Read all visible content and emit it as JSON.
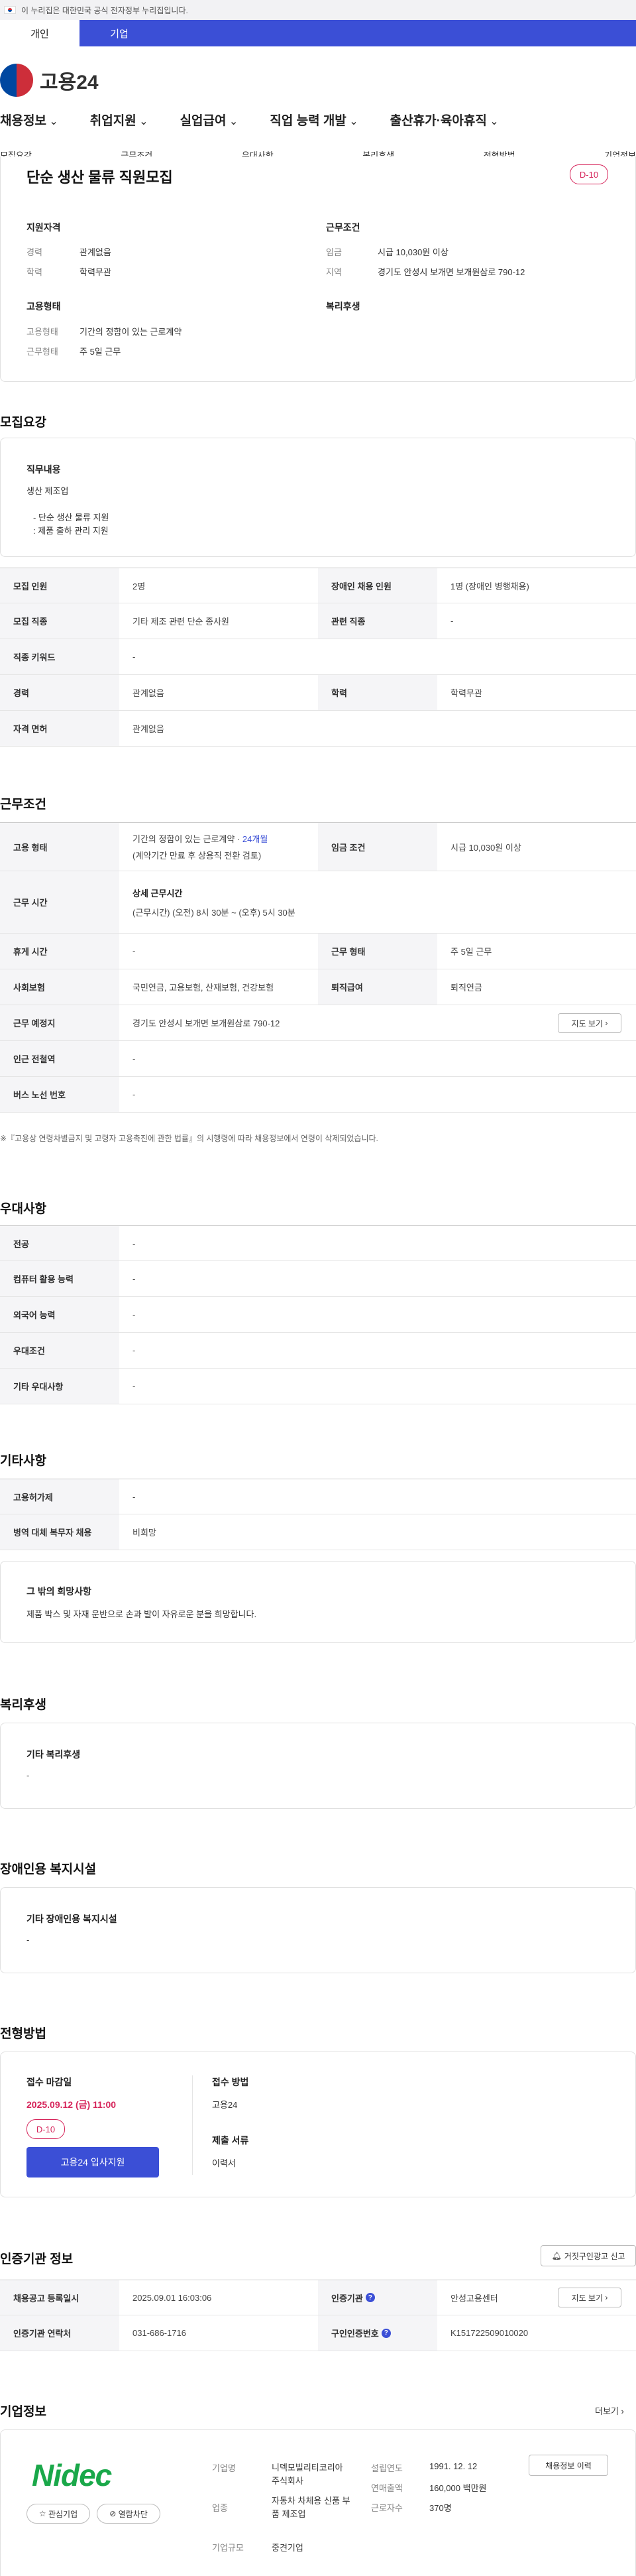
{
  "gov_banner": "이 누리집은 대한민국 공식 전자정부 누리집입니다.",
  "tabs": [
    "개인",
    "기업"
  ],
  "logo": "고용24",
  "gnb": [
    "채용정보",
    "취업지원",
    "실업급여",
    "직업 능력 개발",
    "출산휴가·육아휴직"
  ],
  "anchors": [
    "모집요강",
    "근무조건",
    "우대사항",
    "복리후생",
    "전형방법",
    "기업정보"
  ],
  "job_title": "단순 생산 물류 직원모집",
  "dday": "D-10",
  "summary": {
    "qual_title": "지원자격",
    "cond_title": "근무조건",
    "career_l": "경력",
    "career_v": "관계없음",
    "edu_l": "학력",
    "edu_v": "학력무관",
    "wage_l": "임금",
    "wage_v": "시급 10,030원 이상",
    "loc_l": "지역",
    "loc_v": "경기도 안성시 보개면 보개원삼로 790-12",
    "emp_title": "고용형태",
    "welfare_title": "복리후생",
    "emptype_l": "고용형태",
    "emptype_v": "기간의 정함이 있는 근로계약",
    "worktype_l": "근무형태",
    "worktype_v": "주 5일 근무"
  },
  "recruit": {
    "title": "모집요강",
    "duty_title": "직무내용",
    "duty_lines": [
      "생산 제조업",
      "",
      "- 단순 생산 물류 지원",
      " : 제품 출하 관리 지원"
    ],
    "rows": [
      [
        "모집 인원",
        "2명",
        "장애인 채용 인원",
        "1명 (장애인 병행채용)"
      ],
      [
        "모집 직종",
        "기타 제조 관련 단순 종사원",
        "관련 직종",
        "-"
      ],
      [
        "직종 키워드",
        "-"
      ],
      [
        "경력",
        "관계없음",
        "학력",
        "학력무관"
      ],
      [
        "자격 면허",
        "관계없음"
      ]
    ]
  },
  "work": {
    "title": "근무조건",
    "emp_l": "고용 형태",
    "emp_v1": "기간의 정함이 있는 근로계약 · ",
    "emp_v_link": "24개월",
    "emp_v2": "(계약기간 만료 후 상용직 전환 검토)",
    "wage_l": "임금 조건",
    "wage_v": "시급 10,030원 이상",
    "hours_l": "근무 시간",
    "hours_title": "상세 근무시간",
    "hours_v": "(근무시간) (오전) 8시 30분 ~ (오후) 5시 30분",
    "rest_l": "휴게 시간",
    "rest_v": "-",
    "form_l": "근무 형태",
    "form_v": "주 5일 근무",
    "ins_l": "사회보험",
    "ins_v": "국민연금, 고용보험, 산재보험, 건강보험",
    "ret_l": "퇴직급여",
    "ret_v": "퇴직연금",
    "place_l": "근무 예정지",
    "place_v": "경기도 안성시 보개면 보개원삼로 790-12",
    "map_btn": "지도 보기",
    "subway_l": "인근 전철역",
    "subway_v": "-",
    "bus_l": "버스 노선 번호",
    "bus_v": "-",
    "note": "※『고용상 연령차별금지 및 고령자 고용촉진에 관한 법률』의 시행령에 따라 채용정보에서 연령이 삭제되었습니다."
  },
  "pref": {
    "title": "우대사항",
    "rows": [
      [
        "전공",
        "-"
      ],
      [
        "컴퓨터 활용 능력",
        "-"
      ],
      [
        "외국어 능력",
        "-"
      ],
      [
        "우대조건",
        "-"
      ],
      [
        "기타 우대사항",
        "-"
      ]
    ]
  },
  "etc": {
    "title": "기타사항",
    "rows": [
      [
        "고용허가제",
        "-"
      ],
      [
        "병역 대체 복무자 채용",
        "비희망"
      ]
    ],
    "wish_title": "그 밖의 희망사항",
    "wish_v": "제품 박스 및 자재 운반으로 손과 발이 자유로운 분을 희망합니다."
  },
  "welfare": {
    "title": "복리후생",
    "sub": "기타 복리후생",
    "v": "-"
  },
  "disabled": {
    "title": "장애인용 복지시설",
    "sub": "기타 장애인용 복지시설",
    "v": "-"
  },
  "process": {
    "title": "전형방법",
    "deadline_l": "접수 마감일",
    "deadline_v": "2025.09.12 (금) 11:00",
    "dday": "D-10",
    "apply_btn": "고용24 입사지원",
    "method_l": "접수 방법",
    "method_v": "고용24",
    "docs_l": "제출 서류",
    "docs_v": "이력서"
  },
  "cert": {
    "title": "인증기관 정보",
    "report_btn": "거짓구인광고 신고",
    "reg_l": "채용공고 등록일시",
    "reg_v": "2025.09.01 16:03:06",
    "org_l": "인증기관",
    "org_v": "안성고용센터",
    "org_btn": "지도 보기",
    "tel_l": "인증기관 연락처",
    "tel_v": "031-686-1716",
    "num_l": "구인인증번호",
    "num_v": "K151722509010020"
  },
  "company": {
    "title": "기업정보",
    "more": "더보기",
    "logo_text": "Nidec",
    "fav_btn": "관심기업",
    "block_btn": "열람차단",
    "name_l": "기업명",
    "name_v": "니덱모빌리티코리아 주식회사",
    "ind_l": "업종",
    "ind_v": "자동차 차체용 신품 부품 제조업",
    "size_l": "기업규모",
    "size_v": "중견기업",
    "est_l": "설립연도",
    "est_v": "1991. 12. 12",
    "rev_l": "연매출액",
    "rev_v": "160,000 백만원",
    "emp_l": "근로자수",
    "emp_v": "370명",
    "hist_btn": "채용정보 이력"
  }
}
